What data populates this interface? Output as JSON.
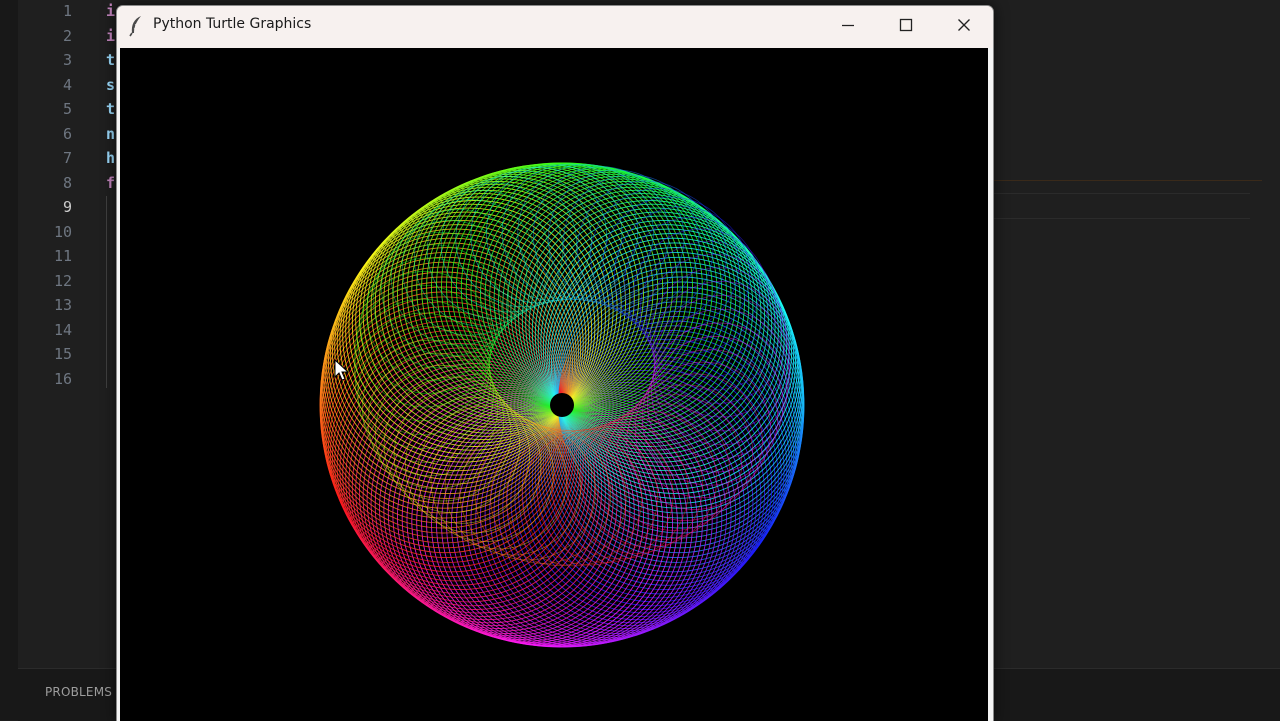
{
  "window": {
    "title": "Python Turtle Graphics",
    "controls": {
      "minimize_icon": "minimize-icon",
      "maximize_icon": "maximize-icon",
      "close_icon": "close-icon"
    }
  },
  "editor": {
    "line_numbers": [
      "1",
      "2",
      "3",
      "4",
      "5",
      "6",
      "7",
      "8",
      "9",
      "10",
      "11",
      "12",
      "13",
      "14",
      "15",
      "16"
    ],
    "active_line": "9",
    "visible_code_chars": [
      {
        "text": "i",
        "color": "#c586c0"
      },
      {
        "text": "i",
        "color": "#c586c0"
      },
      {
        "text": "t",
        "color": "#9cdcfe"
      },
      {
        "text": "s",
        "color": "#9cdcfe"
      },
      {
        "text": "t",
        "color": "#9cdcfe"
      },
      {
        "text": "n",
        "color": "#9cdcfe"
      },
      {
        "text": "h",
        "color": "#9cdcfe"
      },
      {
        "text": "f",
        "color": "#c586c0"
      }
    ]
  },
  "panel": {
    "tab_label": "PROBLEMS"
  },
  "canvas": {
    "background": "#000000",
    "drawing": "rainbow spirograph sphere"
  },
  "colors": {
    "editor_bg": "#1f1f1f",
    "titlebar_bg": "#f7f1ef"
  }
}
